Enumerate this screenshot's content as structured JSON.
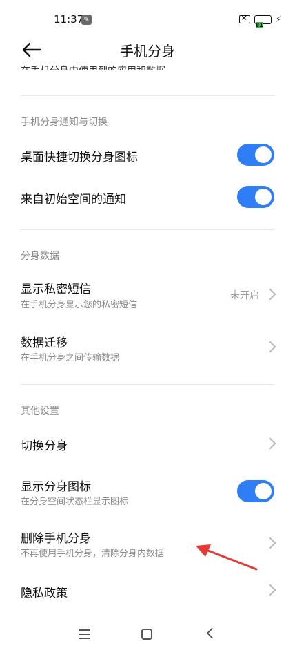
{
  "status_bar": {
    "time": "11:37",
    "battery": "81"
  },
  "header": {
    "title": "手机分身"
  },
  "cutoff_text": "在手机分身中使用到的应用和数据",
  "sections": {
    "notify": {
      "title": "手机分身通知与切换"
    },
    "data": {
      "title": "分身数据"
    },
    "other": {
      "title": "其他设置"
    }
  },
  "rows": {
    "desktop_shortcut": {
      "title": "桌面快捷切换分身图标",
      "enabled": true
    },
    "origin_notify": {
      "title": "来自初始空间的通知",
      "enabled": true
    },
    "private_sms": {
      "title": "显示私密短信",
      "subtitle": "在手机分身显示您的私密短信",
      "value": "未开启"
    },
    "data_migration": {
      "title": "数据迁移",
      "subtitle": "在手机分身之间传输数据"
    },
    "switch_space": {
      "title": "切换分身"
    },
    "show_icon": {
      "title": "显示分身图标",
      "subtitle": "在分身空间状态栏显示图标",
      "enabled": true
    },
    "delete_space": {
      "title": "删除手机分身",
      "subtitle": "不再使用手机分身，清除分身内数据"
    },
    "privacy": {
      "title": "隐私政策"
    }
  },
  "colors": {
    "accent": "#2f7ef5",
    "annotation_arrow": "#e53935"
  }
}
